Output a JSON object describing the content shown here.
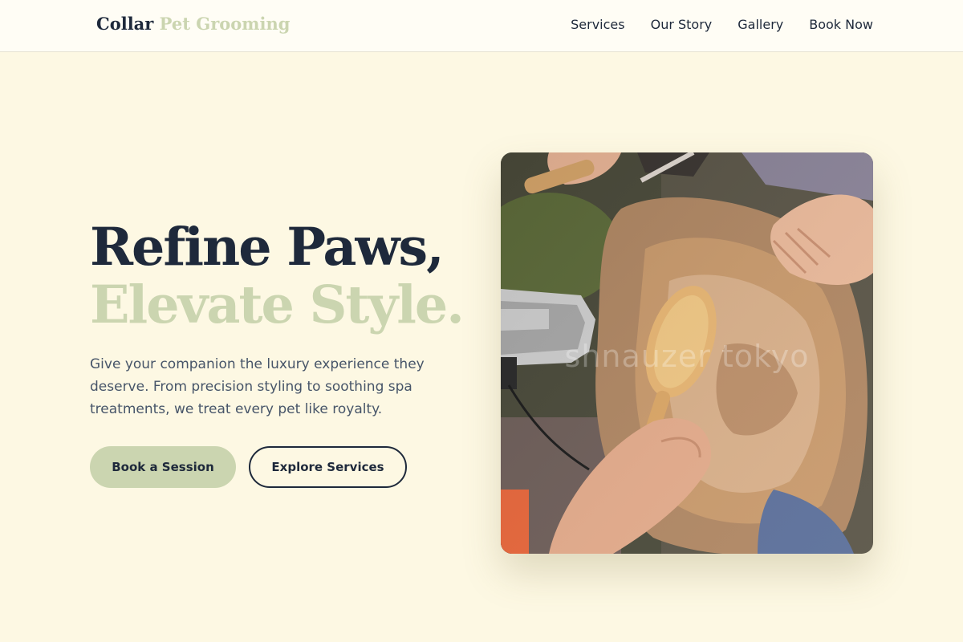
{
  "brand": {
    "name_part1": "Collar",
    "name_part2": "Pet Grooming"
  },
  "nav": {
    "items": [
      "Services",
      "Our Story",
      "Gallery",
      "Book Now"
    ]
  },
  "hero": {
    "headline_line1": "Refine Paws,",
    "headline_line2": "Elevate Style.",
    "lead": "Give your companion the luxury experience they deserve. From precision styling to soothing spa treatments, we treat every pet like royalty.",
    "cta_primary": "Book a Session",
    "cta_secondary": "Explore Services",
    "image_watermark": "shnauzer tokyo",
    "image_alt": "Groomer brushing a golden-haired dog with a wooden brush and dryer"
  },
  "colors": {
    "background": "#fdf8e3",
    "navy": "#1e293b",
    "sage": "#cbd5b0",
    "body_text": "#475569"
  }
}
